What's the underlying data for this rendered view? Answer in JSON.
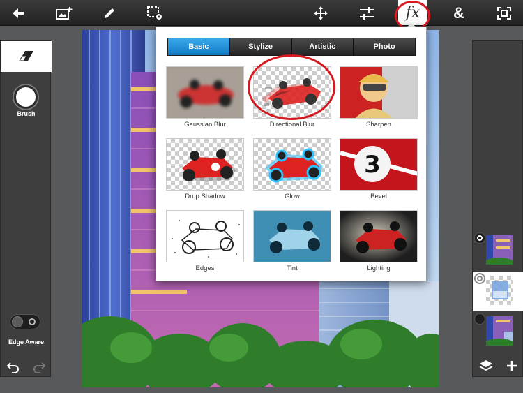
{
  "app": {
    "accent_color": "#1d8fdc",
    "highlight_color": "#d71920"
  },
  "toolbar": {
    "icons": [
      "back-arrow-icon",
      "add-image-icon",
      "pencil-icon",
      "selection-settings-icon",
      "move-icon",
      "adjustments-icon",
      "fx-icon",
      "ampersand-icon",
      "fit-screen-icon"
    ],
    "fx_label": "fx",
    "amp_label": "&"
  },
  "left_panel": {
    "tool_icon": "eraser-icon",
    "brush_label": "Brush",
    "edge_aware_label": "Edge Aware",
    "edge_aware_on": false,
    "undo_icon": "undo-icon",
    "redo_icon": "redo-icon"
  },
  "effects": {
    "tabs": [
      {
        "label": "Basic",
        "active": true
      },
      {
        "label": "Stylize",
        "active": false
      },
      {
        "label": "Artistic",
        "active": false
      },
      {
        "label": "Photo",
        "active": false
      }
    ],
    "items": [
      {
        "label": "Gaussian Blur"
      },
      {
        "label": "Directional Blur"
      },
      {
        "label": "Sharpen"
      },
      {
        "label": "Drop Shadow"
      },
      {
        "label": "Glow"
      },
      {
        "label": "Bevel"
      },
      {
        "label": "Edges"
      },
      {
        "label": "Tint"
      },
      {
        "label": "Lighting"
      }
    ],
    "highlighted_item": "Directional Blur"
  },
  "right_panel": {
    "layers": [
      {
        "name": "layer-1",
        "selected": false
      },
      {
        "name": "layer-2",
        "selected": true
      },
      {
        "name": "layer-3",
        "selected": false
      }
    ],
    "layers_icon": "layers-icon",
    "add_icon": "plus-icon"
  }
}
